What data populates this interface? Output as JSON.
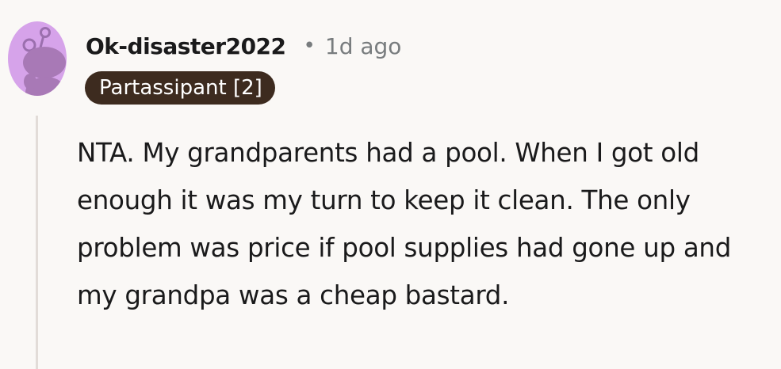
{
  "comment": {
    "avatar_icon": "snoo-avatar-icon",
    "avatar_color": "#d6a3ea",
    "username": "Ok-disaster2022",
    "separator": "•",
    "timestamp": "1d ago",
    "flair": "Partassipant [2]",
    "flair_color": "#3d2b1f",
    "body": "NTA. My grandparents had a pool. When I got old enough it was my turn to keep it clean. The only problem was price if pool supplies had gone up and my grandpa was a cheap bastard."
  }
}
